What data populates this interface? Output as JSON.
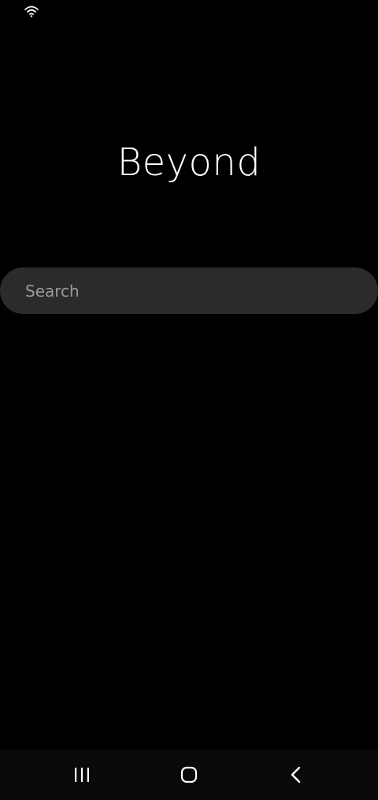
{
  "status_bar": {
    "wifi_icon": "wifi-icon"
  },
  "main": {
    "title": "Beyond",
    "search": {
      "placeholder": "Search"
    }
  },
  "nav_bar": {
    "recents_icon": "recents-icon",
    "home_icon": "home-icon",
    "back_icon": "back-icon"
  },
  "colors": {
    "background": "#000000",
    "search_bg": "#2b2b2b",
    "title_text": "#ffffff",
    "placeholder_text": "#9a9a9a"
  }
}
